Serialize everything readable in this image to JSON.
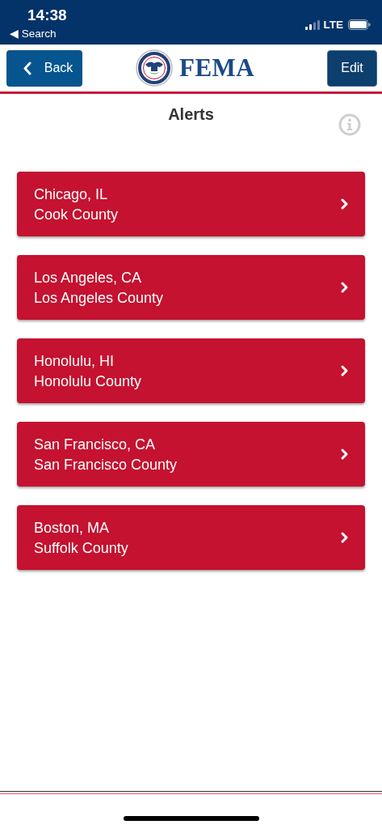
{
  "status_bar": {
    "time": "14:38",
    "back_label": "◀ Search",
    "network": "LTE"
  },
  "header": {
    "back_button": "Back",
    "logo_text": "FEMA",
    "edit_button": "Edit"
  },
  "title": "Alerts",
  "alerts": [
    {
      "city": "Chicago, IL",
      "county": "Cook County"
    },
    {
      "city": "Los Angeles, CA",
      "county": "Los Angeles County"
    },
    {
      "city": "Honolulu, HI",
      "county": "Honolulu County"
    },
    {
      "city": "San Francisco, CA",
      "county": "San Francisco County"
    },
    {
      "city": "Boston, MA",
      "county": "Suffolk County"
    }
  ]
}
